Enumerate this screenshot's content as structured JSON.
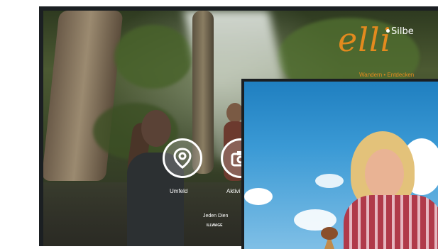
{
  "logo": {
    "wordmark": "elli",
    "subtitle": "Silbe",
    "tagline": "Wandern • Entdecken"
  },
  "nav": {
    "buttons": [
      {
        "label": "Umfeld",
        "icon": "location-pin-icon"
      },
      {
        "label": "Aktivi",
        "icon": "camera-icon"
      }
    ]
  },
  "footer": {
    "text": "Jeden Dien",
    "subtext": "ILLWAGE"
  },
  "colors": {
    "brand": "#e38a1e",
    "frame": "#1b1f22"
  }
}
